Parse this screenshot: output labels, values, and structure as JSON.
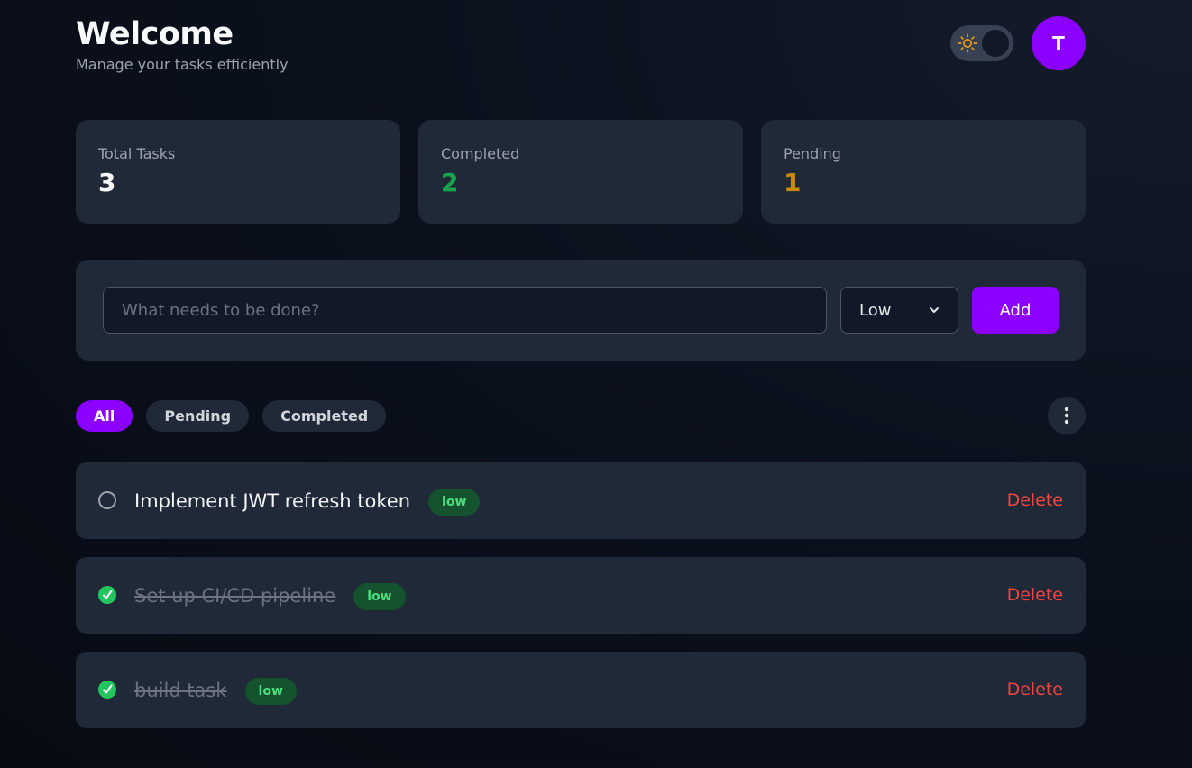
{
  "header": {
    "title": "Welcome",
    "subtitle": "Manage your tasks efficiently",
    "avatar_initial": "T"
  },
  "theme_toggle": {
    "icon": "sun-icon",
    "state": "dark"
  },
  "stats": [
    {
      "label": "Total Tasks",
      "value": "3",
      "color": "#f8fafc"
    },
    {
      "label": "Completed",
      "value": "2",
      "color": "#16a34a"
    },
    {
      "label": "Pending",
      "value": "1",
      "color": "#ca8a04"
    }
  ],
  "add_task": {
    "placeholder": "What needs to be done?",
    "priority_selected": "Low",
    "add_label": "Add"
  },
  "filters": [
    {
      "label": "All",
      "active": true
    },
    {
      "label": "Pending",
      "active": false
    },
    {
      "label": "Completed",
      "active": false
    }
  ],
  "more_icon": "more-vertical-icon",
  "tasks": [
    {
      "text": "Implement JWT refresh token",
      "priority": "low",
      "completed": false,
      "delete_label": "Delete"
    },
    {
      "text": "Set up CI/CD pipeline",
      "priority": "low",
      "completed": true,
      "delete_label": "Delete"
    },
    {
      "text": "build task",
      "priority": "low",
      "completed": true,
      "delete_label": "Delete"
    }
  ],
  "colors": {
    "accent": "#8b00ff",
    "card": "#1f2937",
    "delete": "#ef4444",
    "badge_bg": "#14532d",
    "badge_text": "#4ade80",
    "check_done": "#22c55e"
  }
}
